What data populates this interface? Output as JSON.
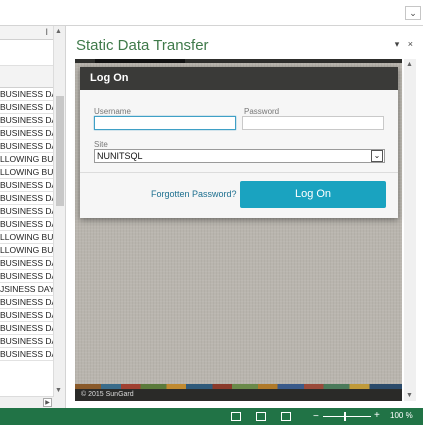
{
  "sheet": {
    "col_header": "I",
    "rows": [
      "BUSINESS DAY",
      "BUSINESS DAY",
      "BUSINESS DAY",
      "BUSINESS DAY",
      "BUSINESS DAY",
      "LLOWING BUSIN",
      "LLOWING BUSIN",
      "BUSINESS DAY",
      "BUSINESS DAY",
      "BUSINESS DAY",
      "BUSINESS DAY",
      "LLOWING BUSIN",
      "LLOWING BUSIN",
      "BUSINESS DAY",
      "BUSINESS DAY",
      "JSINESS DAY",
      "BUSINESS DAY",
      "BUSINESS DAY",
      "BUSINESS DAY",
      "BUSINESS DAY",
      "BUSINESS DAY"
    ]
  },
  "pane": {
    "title": "Static Data Transfer",
    "pin_icon": "▾",
    "close_icon": "×"
  },
  "login": {
    "header": "Log On",
    "username_label": "Username",
    "username_value": "",
    "password_label": "Password",
    "password_value": "",
    "site_label": "Site",
    "site_value": "NUNITSQL",
    "forgot_link": "Forgotten Password?",
    "logon_button": "Log On"
  },
  "footer": {
    "copyright": "© 2015 SunGard"
  },
  "status": {
    "zoom": "100 %"
  },
  "colors": {
    "status_bar": "#217346",
    "pane_title": "#3f7a4a",
    "logon_button": "#1aa3c0",
    "dialog_header": "#3a3a38"
  }
}
